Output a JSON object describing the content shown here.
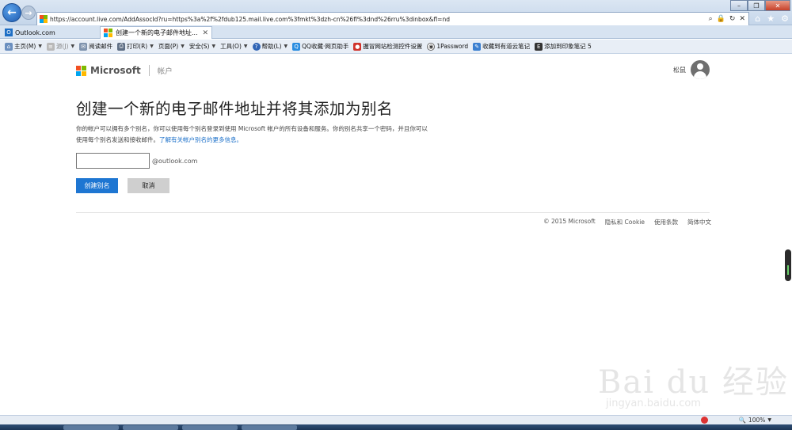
{
  "browser": {
    "url": "https://account.live.com/AddAssocId?ru=https%3a%2f%2fdub125.mail.live.com%3fmkt%3dzh-cn%26fl%3dnd%26rru%3dinbox&fl=nd",
    "tabs": [
      {
        "label": "Outlook.com",
        "active": false
      },
      {
        "label": "创建一个新的电子邮件地址...",
        "active": true
      }
    ],
    "commands": [
      {
        "label": "主页(M)",
        "icon": "home-icon",
        "dim": false
      },
      {
        "label": "源(J)",
        "icon": "feed-icon",
        "dim": true
      },
      {
        "label": "阅读邮件",
        "icon": "mail-icon",
        "dim": false
      },
      {
        "label": "打印(R)",
        "icon": "print-icon",
        "dim": false
      },
      {
        "label": "页面(P)",
        "icon": "page-icon",
        "dim": false
      },
      {
        "label": "安全(S)",
        "icon": "safety-icon",
        "dim": false
      },
      {
        "label": "工具(O)",
        "icon": "tools-icon",
        "dim": false
      },
      {
        "label": "帮助(L)",
        "icon": "help-icon",
        "dim": false
      },
      {
        "label": "QQ收藏·网页助手",
        "icon": "qq-icon",
        "dim": false
      },
      {
        "label": "握冒网站检测控件设置",
        "icon": "plugin-icon",
        "dim": false
      },
      {
        "label": "1Password",
        "icon": "1password-icon",
        "dim": false
      },
      {
        "label": "收藏到有道云笔记",
        "icon": "youdao-icon",
        "dim": false
      },
      {
        "label": "添加到印象笔记 5",
        "icon": "evernote-icon",
        "dim": false
      }
    ],
    "zoom": "100%"
  },
  "header": {
    "brand": "Microsoft",
    "section": "帐户",
    "user_name": "松鼠"
  },
  "main": {
    "title": "创建一个新的电子邮件地址并将其添加为别名",
    "description": "你的帐户可以拥有多个别名，你可以使用每个别名登录到使用 Microsoft 帐户的所有设备和服务。你的别名共享一个密码，并且你可以使用每个别名发送和接收邮件。",
    "learn_more_link": "了解有关帐户别名的更多信息。",
    "alias_input_value": "",
    "alias_suffix": "@outlook.com",
    "create_button": "创建别名",
    "cancel_button": "取消"
  },
  "footer": {
    "copyright": "© 2015 Microsoft",
    "privacy": "隐私和 Cookie",
    "terms": "使用条款",
    "language": "简体中文"
  },
  "watermark": {
    "text": "Bai du 经验",
    "sub": "jingyan.baidu.com"
  },
  "colors": {
    "primary_button": "#1e76d2",
    "link": "#1a6fc9",
    "ms_red": "#f25022",
    "ms_green": "#7fba00",
    "ms_blue": "#00a4ef",
    "ms_yellow": "#ffb900"
  }
}
